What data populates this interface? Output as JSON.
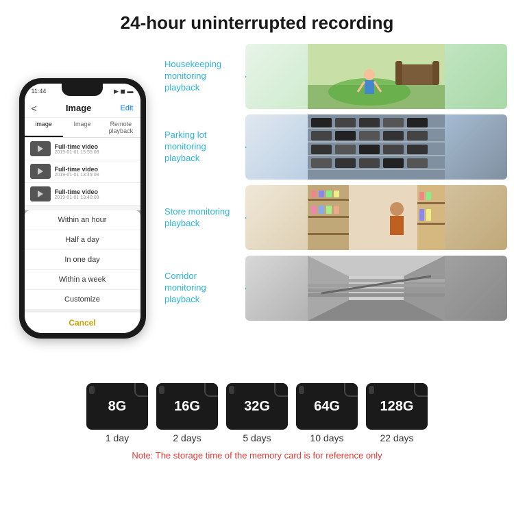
{
  "header": {
    "title": "24-hour uninterrupted recording"
  },
  "phone": {
    "status_time": "11:44",
    "nav_title": "Image",
    "nav_back": "<",
    "nav_edit": "Edit",
    "tabs": [
      "image",
      "Image",
      "Remote playback"
    ],
    "list_items": [
      {
        "title": "Full-time video",
        "date": "2019-01-01 15:55:08"
      },
      {
        "title": "Full-time video",
        "date": "2019-01-01 13:45:08"
      },
      {
        "title": "Full-time video",
        "date": "2019-01-01 13:40:08"
      }
    ],
    "dropdown_items": [
      "Within an hour",
      "Half a day",
      "In one day",
      "Within a week",
      "Customize"
    ],
    "dropdown_cancel": "Cancel"
  },
  "monitoring": [
    {
      "label": "Housekeeping monitoring playback",
      "scene": "housekeeping"
    },
    {
      "label": "Parking lot monitoring playback",
      "scene": "parking"
    },
    {
      "label": "Store monitoring playback",
      "scene": "store"
    },
    {
      "label": "Corridor monitoring playback",
      "scene": "corridor"
    }
  ],
  "sdcards": [
    {
      "size": "8G",
      "days": "1 day"
    },
    {
      "size": "16G",
      "days": "2 days"
    },
    {
      "size": "32G",
      "days": "5 days"
    },
    {
      "size": "64G",
      "days": "10 days"
    },
    {
      "size": "128G",
      "days": "22 days"
    }
  ],
  "note": "Note: The storage time of the memory card is for reference only"
}
